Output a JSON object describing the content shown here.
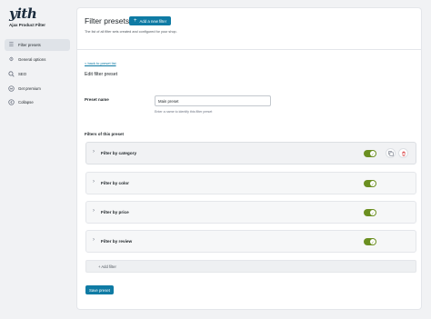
{
  "sidebar": {
    "logo": "yith",
    "plugin_name": "Ajax Product Filter",
    "items": [
      {
        "label": "Filter presets",
        "icon": "list-icon",
        "active": true
      },
      {
        "label": "General options",
        "icon": "gear-icon",
        "active": false
      },
      {
        "label": "SEO",
        "icon": "search-icon",
        "active": false
      },
      {
        "label": "Get premium",
        "icon": "premium-icon",
        "active": false
      },
      {
        "label": "Collapse",
        "icon": "collapse-icon",
        "active": false
      }
    ]
  },
  "header": {
    "title": "Filter presets",
    "add_button_label": "Add a new filter",
    "description": "The list of all filter sets created and configured for your shop."
  },
  "form": {
    "back_link": "< back to preset list",
    "section_title": "Edit filter preset",
    "preset_name_label": "Preset name",
    "preset_name_value": "Main preset",
    "preset_name_help": "Enter a name to identify this filter preset",
    "filters_label": "Filters of this preset",
    "filters": [
      {
        "name": "Filter by category",
        "enabled": true
      },
      {
        "name": "Filter by color",
        "enabled": true
      },
      {
        "name": "Filter by price",
        "enabled": true
      },
      {
        "name": "Filter by review",
        "enabled": true
      }
    ],
    "add_filter_label": "+ Add filter",
    "save_button_label": "Save preset"
  },
  "colors": {
    "accent": "#0f7ba4",
    "toggle_on": "#6b8f21",
    "delete": "#d63638"
  }
}
